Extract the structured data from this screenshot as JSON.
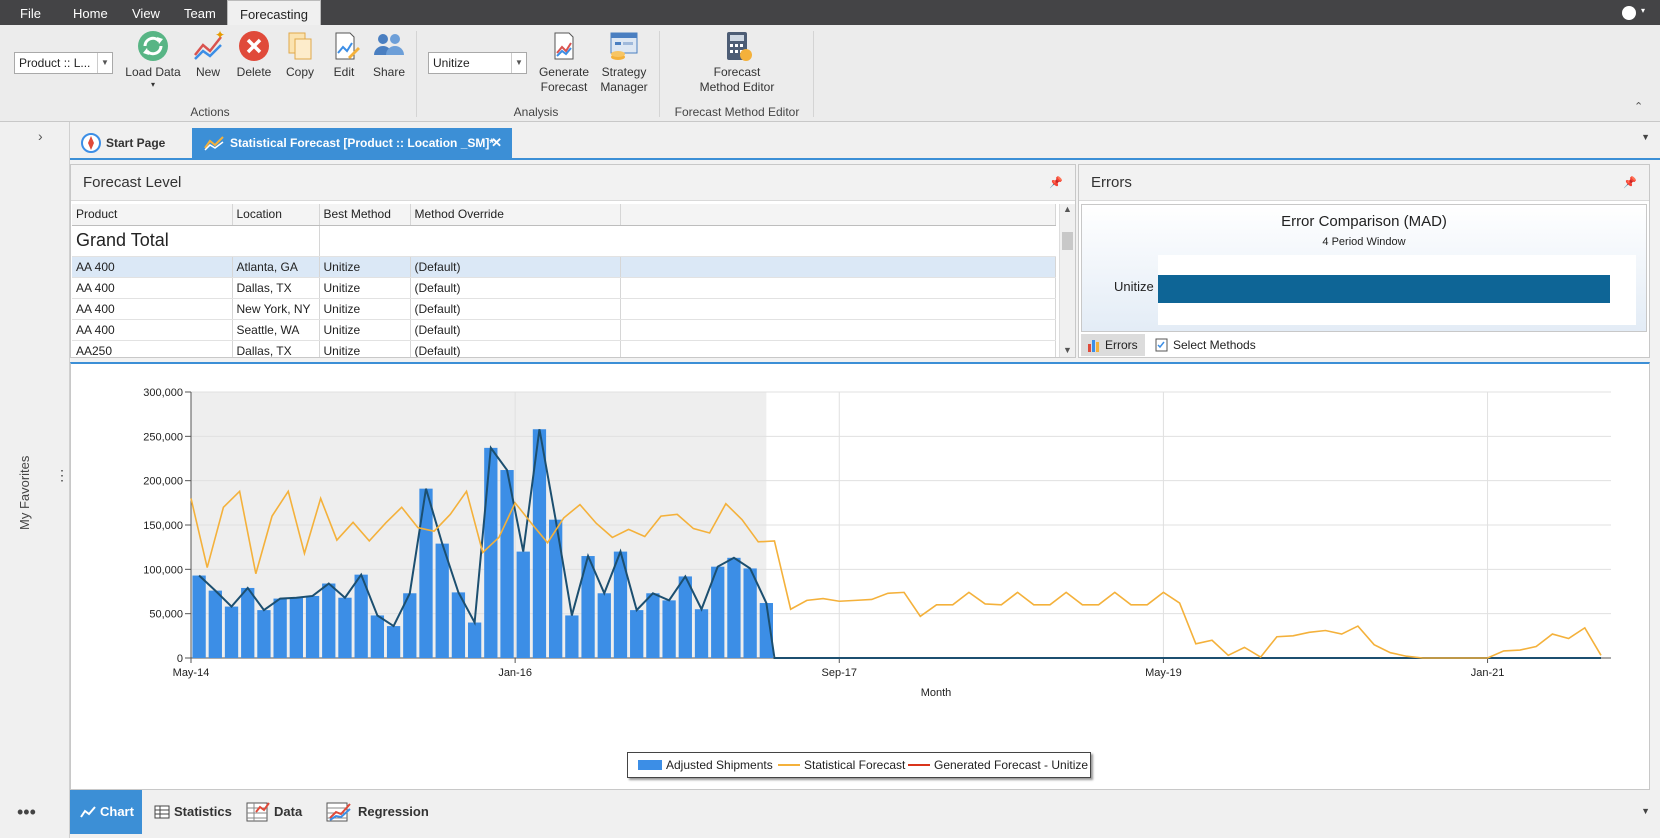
{
  "menu": {
    "tabs": [
      "File",
      "Home",
      "View",
      "Team",
      "Forecasting"
    ],
    "active": "Forecasting"
  },
  "ribbon": {
    "product_combo": "Product :: L...",
    "method_combo": "Unitize",
    "buttons": {
      "load_data": "Load Data",
      "new": "New",
      "delete": "Delete",
      "copy": "Copy",
      "edit": "Edit",
      "share": "Share",
      "generate_forecast_1": "Generate",
      "generate_forecast_2": "Forecast",
      "strategy_manager_1": "Strategy",
      "strategy_manager_2": "Manager",
      "forecast_method_editor_1": "Forecast",
      "forecast_method_editor_2": "Method Editor"
    },
    "groups": {
      "actions": "Actions",
      "analysis": "Analysis",
      "fme": "Forecast Method Editor"
    }
  },
  "sidebar": {
    "favorites_label": "My Favorites"
  },
  "doc_tabs": {
    "start_page": "Start Page",
    "statistical_forecast": "Statistical Forecast [Product :: Location _SM]*"
  },
  "forecast_level": {
    "title": "Forecast Level",
    "columns": [
      "Product",
      "Location",
      "Best Method",
      "Method Override"
    ],
    "grand_total": "Grand Total",
    "rows": [
      {
        "product": "AA 400",
        "location": "Atlanta, GA",
        "best": "Unitize",
        "override": "(Default)"
      },
      {
        "product": "AA 400",
        "location": "Dallas, TX",
        "best": "Unitize",
        "override": "(Default)"
      },
      {
        "product": "AA 400",
        "location": "New York, NY",
        "best": "Unitize",
        "override": "(Default)"
      },
      {
        "product": "AA 400",
        "location": "Seattle, WA",
        "best": "Unitize",
        "override": "(Default)"
      },
      {
        "product": "AA250",
        "location": "Dallas, TX",
        "best": "Unitize",
        "override": "(Default)"
      }
    ]
  },
  "errors": {
    "title": "Errors",
    "chart_title": "Error Comparison (MAD)",
    "chart_subtitle": "4 Period Window",
    "bar_label": "Unitize",
    "bar_color": "#0e6596",
    "tab_errors": "Errors",
    "tab_select_methods": "Select Methods"
  },
  "chart_data": {
    "type": "bar",
    "xlabel": "Month",
    "ylabel": "",
    "ylim": [
      0,
      300000
    ],
    "yticks": [
      "0",
      "50,000",
      "100,000",
      "150,000",
      "200,000",
      "250,000",
      "300,000"
    ],
    "xticks": [
      "May-14",
      "Jan-16",
      "Sep-17",
      "May-19",
      "Jan-21"
    ],
    "series": [
      {
        "name": "Adjusted Shipments",
        "color": "#3c8ee6",
        "values": [
          93000,
          76000,
          58000,
          79000,
          54000,
          67000,
          68000,
          70000,
          84000,
          68000,
          94000,
          48000,
          36000,
          73000,
          191000,
          129000,
          74000,
          40000,
          237000,
          212000,
          120000,
          258000,
          156000,
          48000,
          115000,
          73000,
          120000,
          54000,
          73000,
          65000,
          92000,
          55000,
          103000,
          113000,
          101000,
          62000
        ]
      },
      {
        "name": "Statistical Forecast",
        "color": "#f4b13b",
        "values": [
          180000,
          102000,
          170000,
          188000,
          95000,
          160000,
          188000,
          118000,
          180000,
          133000,
          153000,
          132000,
          152000,
          170000,
          147000,
          143000,
          162000,
          188000,
          119000,
          136000,
          175000,
          152000,
          130000,
          158000,
          173000,
          152000,
          136000,
          145000,
          137000,
          160000,
          162000,
          146000,
          141000,
          174000,
          156000,
          131000,
          132000,
          55000,
          65000,
          67000,
          64000,
          65000,
          66000,
          73000,
          74000,
          47000,
          60000,
          60000,
          74000,
          61000,
          60000,
          74000,
          60000,
          60000,
          74000,
          60000,
          60000,
          74000,
          60000,
          60000,
          74000,
          62000,
          16000,
          20000,
          3000,
          12000,
          1000,
          24000,
          25000,
          29000,
          31000,
          27000,
          36000,
          15000,
          6000,
          2000,
          0,
          0,
          0,
          0,
          0,
          8000,
          9000,
          13000,
          27000,
          22000,
          34000,
          3000
        ]
      },
      {
        "name": "Generated Forecast - Unitize",
        "color": "#d9341b",
        "values": []
      }
    ],
    "line_overlay_color": "#1c4f70",
    "history_shade": "#eeeeee"
  },
  "bottom_tabs": {
    "chart": "Chart",
    "statistics": "Statistics",
    "data": "Data",
    "regression": "Regression"
  }
}
